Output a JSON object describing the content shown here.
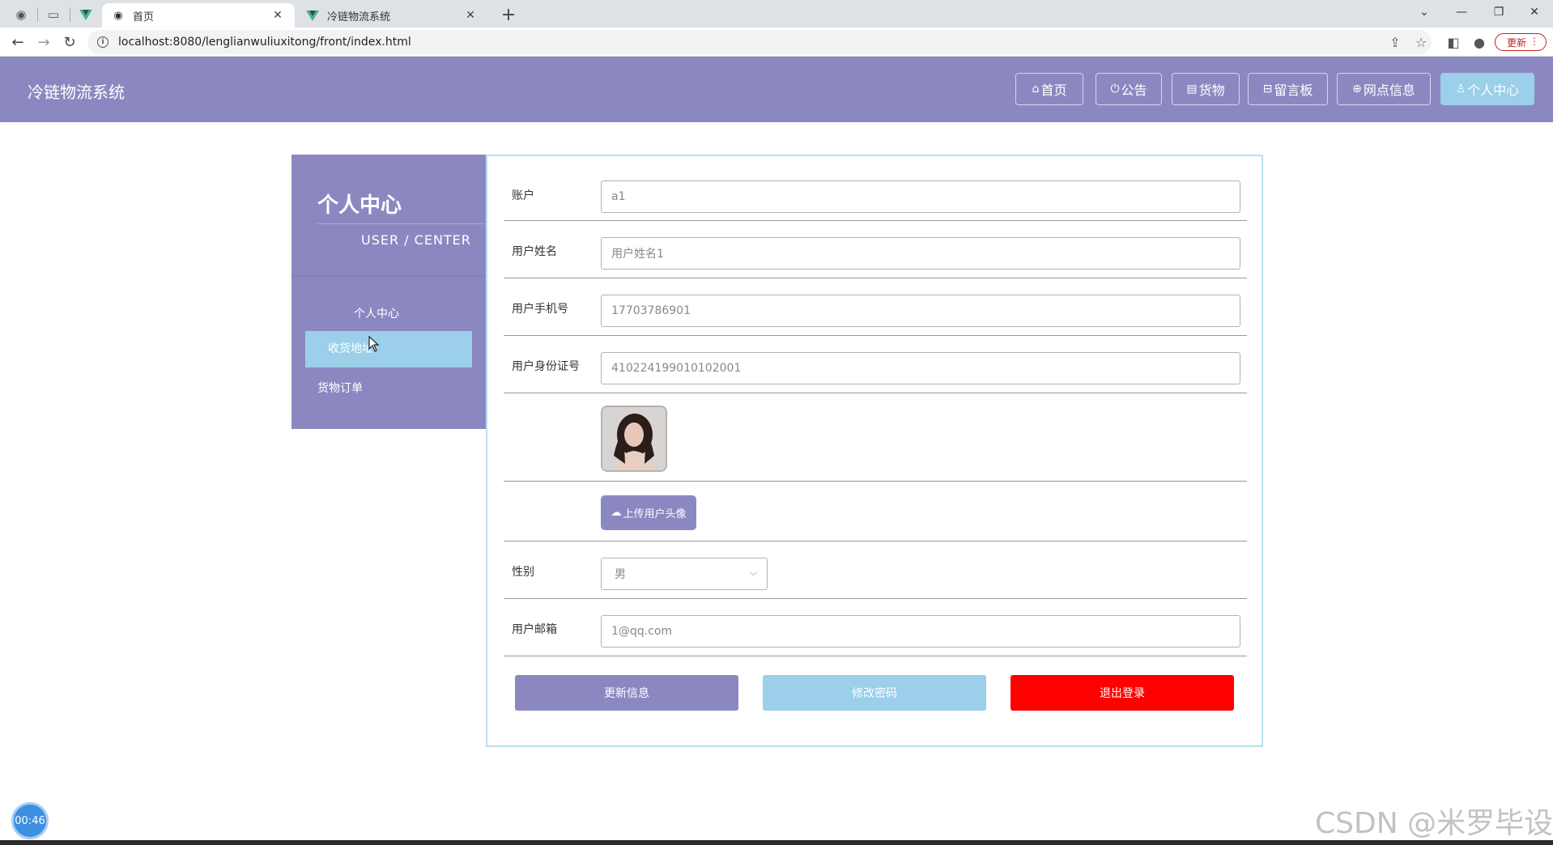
{
  "browser": {
    "tabs": [
      {
        "title": "首页",
        "active": true
      },
      {
        "title": "冷链物流系统",
        "active": false
      }
    ],
    "url": "localhost:8080/lenglianwuliuxitong/front/index.html",
    "update_label": "更新"
  },
  "header": {
    "title": "冷链物流系统",
    "nav": [
      {
        "label": "首页",
        "icon": "home-icon"
      },
      {
        "label": "公告",
        "icon": "power-icon"
      },
      {
        "label": "货物",
        "icon": "box-icon"
      },
      {
        "label": "留言板",
        "icon": "message-icon"
      },
      {
        "label": "网点信息",
        "icon": "globe-icon"
      },
      {
        "label": "个人中心",
        "icon": "user-icon",
        "active": true
      }
    ]
  },
  "sidebar": {
    "title": "个人中心",
    "subtitle": "USER / CENTER",
    "items": [
      {
        "label": "个人中心"
      },
      {
        "label": "收货地址",
        "highlighted": true
      },
      {
        "label": "货物订单"
      }
    ]
  },
  "form": {
    "account": {
      "label": "账户",
      "value": "a1"
    },
    "name": {
      "label": "用户姓名",
      "value": "用户姓名1"
    },
    "phone": {
      "label": "用户手机号",
      "value": "17703786901"
    },
    "idcard": {
      "label": "用户身份证号",
      "value": "410224199010102001"
    },
    "upload_label": "上传用户头像",
    "gender": {
      "label": "性别",
      "value": "男"
    },
    "email": {
      "label": "用户邮箱",
      "value": "1@qq.com"
    },
    "buttons": {
      "update": "更新信息",
      "password": "修改密码",
      "logout": "退出登录"
    }
  },
  "overlay": {
    "timer": "00:46",
    "watermark": "CSDN @米罗毕设"
  },
  "colors": {
    "primary": "#8b88c1",
    "accent": "#9bcfea",
    "danger": "#ff0000"
  }
}
